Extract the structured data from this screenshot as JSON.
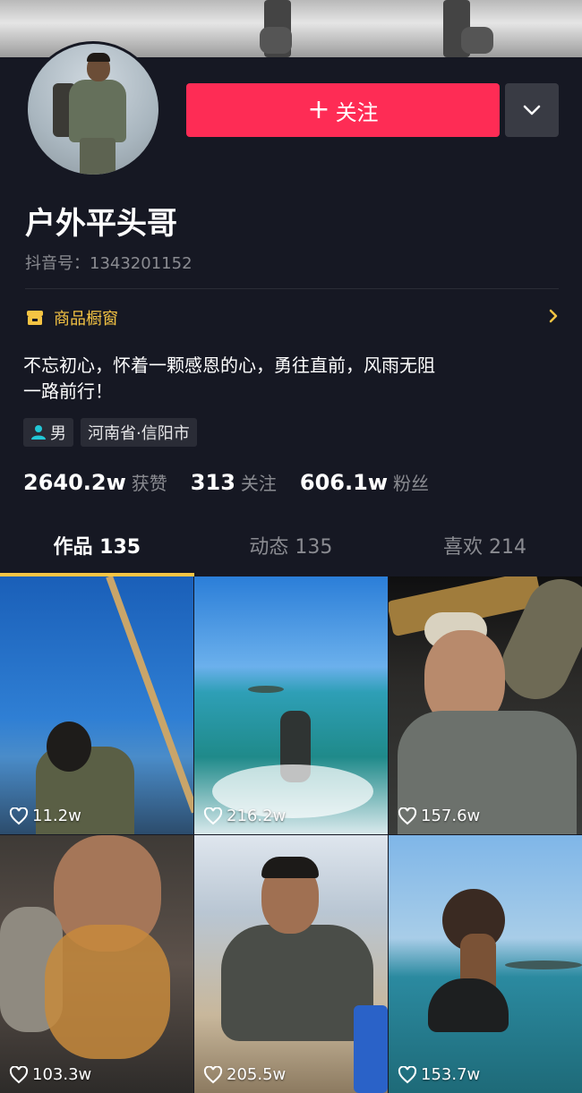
{
  "profile": {
    "follow_label": "关注",
    "name": "户外平头哥",
    "douyin_id": "抖音号：1343201152",
    "shop_label": "商品橱窗",
    "bio_line1": "不忘初心，怀着一颗感恩的心，勇往直前，风雨无阻",
    "bio_line2": "一路前行！",
    "tags": {
      "gender": "男",
      "location": "河南省·信阳市"
    },
    "stats": {
      "likes_num": "2640.2w",
      "likes_label": "获赞",
      "following_num": "313",
      "following_label": "关注",
      "fans_num": "606.1w",
      "fans_label": "粉丝"
    }
  },
  "tabs": [
    {
      "label": "作品 135"
    },
    {
      "label": "动态 135"
    },
    {
      "label": "喜欢 214"
    }
  ],
  "videos": [
    {
      "likes": "11.2w"
    },
    {
      "likes": "216.2w"
    },
    {
      "likes": "157.6w"
    },
    {
      "likes": "103.3w"
    },
    {
      "likes": "205.5w"
    },
    {
      "likes": "153.7w"
    }
  ],
  "colors": {
    "accent_red": "#fe2c55",
    "accent_yellow": "#f5c443",
    "background": "#161823"
  },
  "icons": {
    "follow": "plus-icon",
    "more": "chevron-down-icon",
    "shop": "shop-icon",
    "shop_arrow": "chevron-right-icon",
    "gender": "person-icon",
    "like": "heart-icon"
  }
}
